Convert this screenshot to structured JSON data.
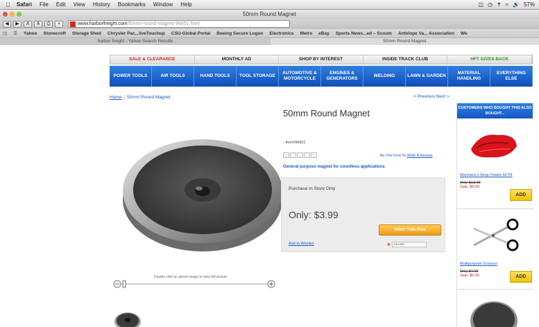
{
  "menubar": {
    "app": "Safari",
    "items": [
      "File",
      "Edit",
      "View",
      "History",
      "Bookmarks",
      "Window",
      "Help"
    ],
    "battery": "57%"
  },
  "window": {
    "title": "50mm Round Magnet"
  },
  "toolbar": {
    "url_domain": "www.harborfreight.com",
    "url_path": "/50mm-round-magnet-96651.html"
  },
  "bookmarks": [
    "Yahoo",
    "Stonecroft",
    "Storage Shed",
    "Chrysler Pac...liveTouchup",
    "CSU-Global Portal",
    "Boeing Secure Logon",
    "Electronics",
    "Metro",
    "eBay",
    "Sports News...ed – Scoom",
    "Antelope Va... Association",
    "We"
  ],
  "tabs": [
    "harbor freight - Yahoo Search Results",
    "50mm Round Magnet"
  ],
  "topnav": [
    "SALE & CLEARANCE",
    "MONTHLY AD",
    "SHOP BY INTEREST",
    "INSIDE TRACK CLUB",
    "HFT GIVES BACK"
  ],
  "catnav": [
    "POWER TOOLS",
    "AIR TOOLS",
    "HAND TOOLS",
    "TOOL STORAGE",
    "AUTOMOTIVE & MOTORCYCLE",
    "ENGINES & GENERATORS",
    "WELDING",
    "LAWN & GARDEN",
    "MATERIAL HANDLING",
    "EVERYTHING ELSE"
  ],
  "breadcrumb": {
    "home": "Home",
    "current": "50mm Round Magnet"
  },
  "prevnext": "< Previous  Next >",
  "product": {
    "title": "50mm Round Magnet",
    "item_number": "- Item#96651",
    "review_prompt": "Be The First To",
    "review_link": "Write A Review",
    "description": "General purpose magnet for countless applications",
    "store_note": "Purchase In Store Only",
    "price": "Only: $3.99",
    "print_label": "PRINT THIS ITEM",
    "wishlist": "Add to Wishlist",
    "share": "SHARE",
    "zoom_hint": "Double click on above image to view full picture"
  },
  "sidebar": {
    "heading": "CUSTOMERS WHO BOUGHT THIS ALSO BOUGHT...",
    "items": [
      {
        "name": "Mechanic's Shop Towels 50 Pk",
        "was": "Only $13.99",
        "sale": "Sale: $9.99",
        "add": "ADD"
      },
      {
        "name": "Multipurpose Scissors",
        "was": "Only $4.99",
        "sale": "Sale: $0.99",
        "add": "ADD"
      }
    ]
  },
  "colors": {
    "nav_blue": "#1a5fcc",
    "sale_red": "#d32222",
    "print_orange": "#f5a623",
    "add_yellow": "#f6cf18"
  }
}
